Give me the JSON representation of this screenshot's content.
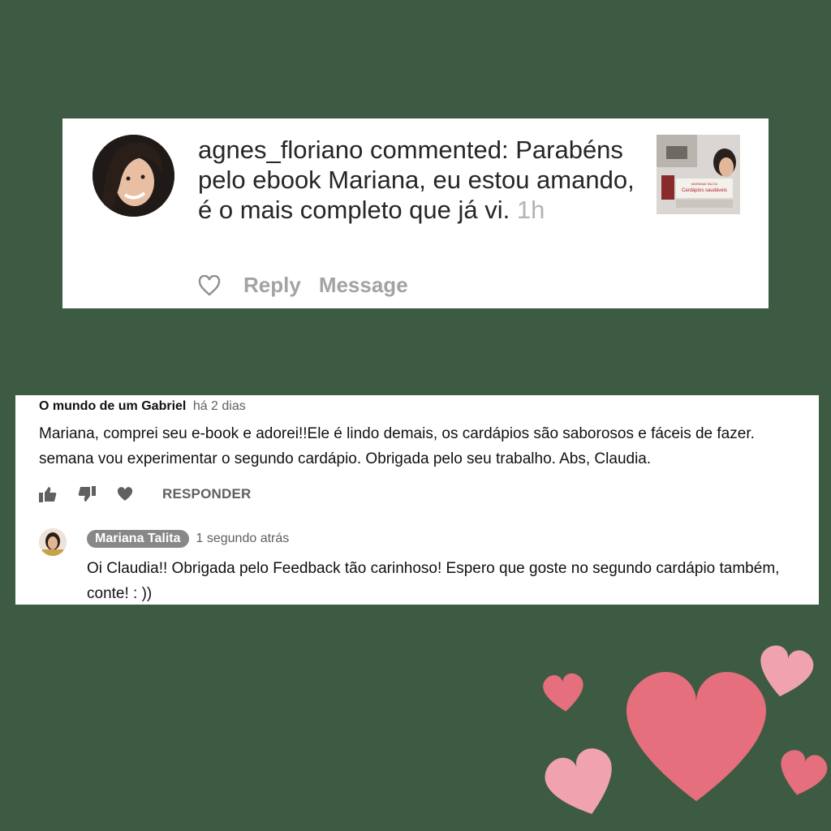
{
  "instagram": {
    "username": "agnes_floriano",
    "action": " commented:",
    "comment": "Parabéns pelo ebook Mariana, eu estou amando, é o mais completo que já vi.",
    "time": "1h",
    "reply_label": "Reply",
    "message_label": "Message",
    "thumbnail_title": "Cardápios saudáveis"
  },
  "youtube": {
    "author": "O mundo de um Gabriel",
    "date": "há 2 dias",
    "comment_line1": "Mariana, comprei seu e-book e adorei!!Ele é lindo demais, os cardápios são saborosos e fáceis de fazer.",
    "comment_line2": "semana vou experimentar o segundo cardápio. Obrigada pelo seu trabalho. Abs, Claudia.",
    "respond_label": "RESPONDER",
    "reply": {
      "author": "Mariana Talita",
      "date": "1 segundo atrás",
      "line1": "Oi Claudia!! Obrigada pelo Feedback tão carinhoso! Espero que goste no segundo cardápio também,",
      "line2": "conte!  : ))"
    }
  },
  "colors": {
    "background": "#3d5b42",
    "heart_pink": "#e56f7c",
    "heart_light": "#f0a3ad"
  }
}
